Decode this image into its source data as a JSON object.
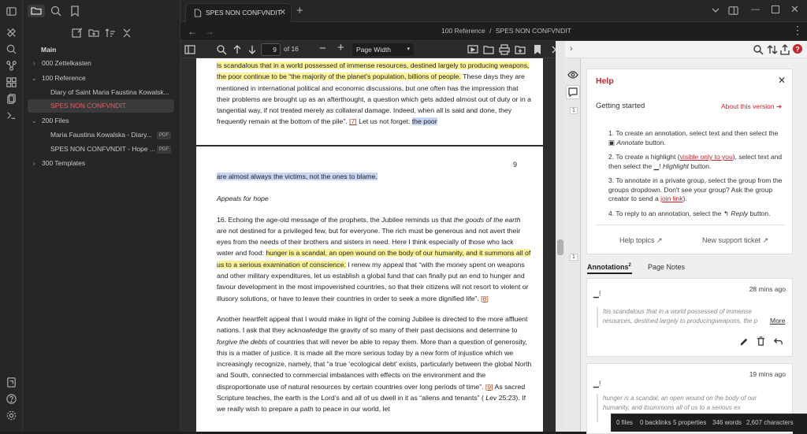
{
  "tab": {
    "title": "SPES NON CONFVNDIT"
  },
  "breadcrumb": {
    "folder": "100 Reference",
    "sep": "/",
    "file": "SPES NON CONFVNDIT"
  },
  "explorer": {
    "vault_root": "Main",
    "items": [
      {
        "label": "000 Zettelkasten",
        "chev": "›"
      },
      {
        "label": "100 Reference",
        "chev": "⌄"
      },
      {
        "label": "Diary of Saint Maria Faustina Kowalsk..."
      },
      {
        "label": "SPES NON CONFVNDIT"
      },
      {
        "label": "200 Files",
        "chev": "⌄"
      },
      {
        "label": "Maria Faustina Kowalska - Diary...",
        "badge": "PDF"
      },
      {
        "label": "SPES NON CONFVNDIT - Hope ...",
        "badge": "PDF"
      },
      {
        "label": "300 Templates",
        "chev": "›"
      }
    ]
  },
  "pdf_toolbar": {
    "page": "9",
    "of": "of 16",
    "zoom": "Page Width"
  },
  "pdf": {
    "p1_a": "is scandalous that in a world possessed of immense resources, destined largely to producing weapons, the poor continue to be “the majority of the planet’s population, billions of people.",
    "p1_b": " These days they are mentioned in international political and economic discussions, but one often has the impression that their problems are brought up as an afterthought, a question which gets added almost out of duty or in a tangential way, if not treated merely as collateral damage. Indeed, when all is said and done, they frequently remain at the bottom of the pile”. ",
    "p1_ref": "[7]",
    "p1_c": " Let us not forget: ",
    "p1_d": "the poor",
    "page_num": "9",
    "p2_a": "are almost always the victims, not the ones to blame.",
    "heading": "Appeals for hope",
    "p3_a": "16. Echoing the age-old message of the prophets, the Jubilee reminds us that ",
    "p3_i": "the goods of the earth",
    "p3_b": " are not destined for a privileged few, but for everyone. The rich must be generous and not avert their eyes from the needs of their brothers and sisters in need. Here I think especially of those who lack water and food: ",
    "p3_h": "hunger is a scandal, an open wound on the body of our humanity, and it summons all of us to a serious examination of conscience.",
    "p3_c": " I renew my appeal that “with the money spent on weapons and other military expenditures, let us establish a global fund that can finally put an end to hunger and favour development in the most impoverished countries, so that their citizens will not resort to violent or illusory solutions, or have to leave their countries in order to seek a more dignified life”. ",
    "p3_ref": "[8]",
    "p4_a": "Another heartfelt appeal that I would make in light of the coming Jubilee is directed to the more affluent nations. I ask that they acknowledge the gravity of so many of their past decisions and determine to ",
    "p4_i": "forgive the debts",
    "p4_b": " of countries that will never be able to repay them. More than a question of generosity, this is a matter of justice. It is made all the more serious today by a new form of injustice which we increasingly recognize, namely, that “a true ‘ecological debt’ exists, particularly between the global North and South, connected to commercial imbalances with effects on the environment and the disproportionate use of natural resources by certain countries over long periods of time”. ",
    "p4_ref": "[9]",
    "p4_c": " As sacred Scripture teaches, the earth is the Lord’s and all of us dwell in it as “aliens and tenants” ( ",
    "p4_i2": "Lev",
    "p4_d": " 25:23). If we really wish to prepare a path to peace in our world, let"
  },
  "help": {
    "title": "Help",
    "getting_started": "Getting started",
    "about": "About this version",
    "step1_a": "To create an annotation, select text and then select the",
    "step1_b": "Annotate",
    "step1_c": "button.",
    "step2_a": "To create a highlight (",
    "step2_link": "visible only to you",
    "step2_b": "), select text",
    "step2_c": "and then select the",
    "step2_d": "Highlight",
    "step2_e": "button.",
    "step3_a": "To annotate in a private group, select the group from the groups dropdown. Don't see your group? Ask the group creator to send a",
    "step3_link": "join link",
    "step3_b": ").",
    "step4_a": "To reply to an annotation, select the",
    "step4_b": "Reply",
    "step4_c": "button.",
    "help_topics": "Help topics",
    "support": "New support ticket"
  },
  "annotations": {
    "tab_label": "Annotations",
    "count": "2",
    "page_notes": "Page Notes",
    "badge_count": "1",
    "cards": [
      {
        "time": "28 mins ago",
        "quote": "Itis scandalous that in a world possessed of immense resources, destined largely to producingweapons, the p",
        "more": "More"
      },
      {
        "time": "19 mins ago",
        "quote": "hunger is a scandal, an open wound on the body of our humanity, and itsummons all of us to a serious ex"
      }
    ]
  },
  "statusbar": {
    "files": "0 files",
    "backlinks": "0 backlinks",
    "properties": "5 properties",
    "words": "346 words",
    "chars": "2,607 characters"
  }
}
